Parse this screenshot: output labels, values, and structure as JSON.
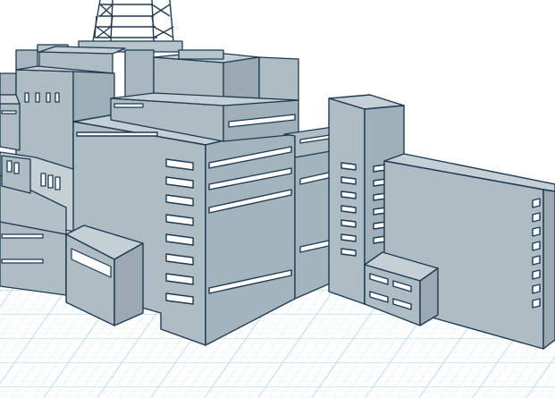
{
  "viewport": {
    "background": "#ffffff",
    "grid_color": "#7fb6d8",
    "grid_fine_color": "#cfe4f2",
    "model_fill": "#aebcc4",
    "model_light": "#c4d0d6",
    "model_dark": "#9aa9b2",
    "edge_color": "#1f3a52",
    "window_color": "#ffffff"
  },
  "objects": [
    {
      "name": "radio-tower"
    },
    {
      "name": "main-building"
    },
    {
      "name": "stair-tower"
    },
    {
      "name": "right-block"
    },
    {
      "name": "left-wing"
    },
    {
      "name": "front-annex"
    },
    {
      "name": "small-annex"
    }
  ]
}
